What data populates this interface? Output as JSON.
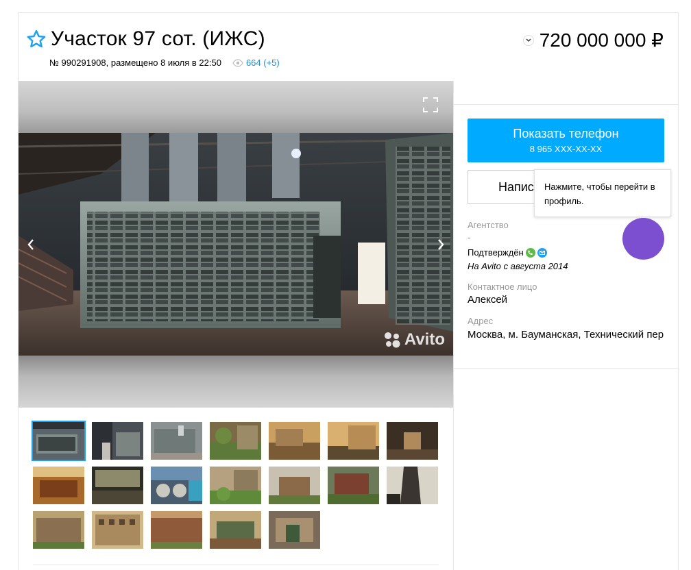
{
  "listing": {
    "title": "Участок 97 сот. (ИЖС)",
    "meta": "№ 990291908, размещено 8 июля в 22:50",
    "views": "664 (+5)",
    "price": "720 000 000 ₽"
  },
  "gallery": {
    "watermark": "Avito",
    "thumb_count": 19
  },
  "sidebar": {
    "phone_label": "Показать телефон",
    "phone_number": "8 965 XXX-XX-XX",
    "write_label": "Написать",
    "tooltip": "Нажмите, чтобы перейти в профиль.",
    "agency_label": "Агентство",
    "agency_value": "-",
    "verified": "Подтверждён",
    "since": "На Avito с августа 2014",
    "contact_label": "Контактное лицо",
    "contact_value": "Алексей",
    "address_label": "Адрес",
    "address_value": "Москва, м. Бауманская, Технический пер"
  },
  "colors": {
    "accent": "#00aaff",
    "avatar": "#7c4fd1",
    "link": "#1a8ed6",
    "star": "#1ea1f2"
  }
}
